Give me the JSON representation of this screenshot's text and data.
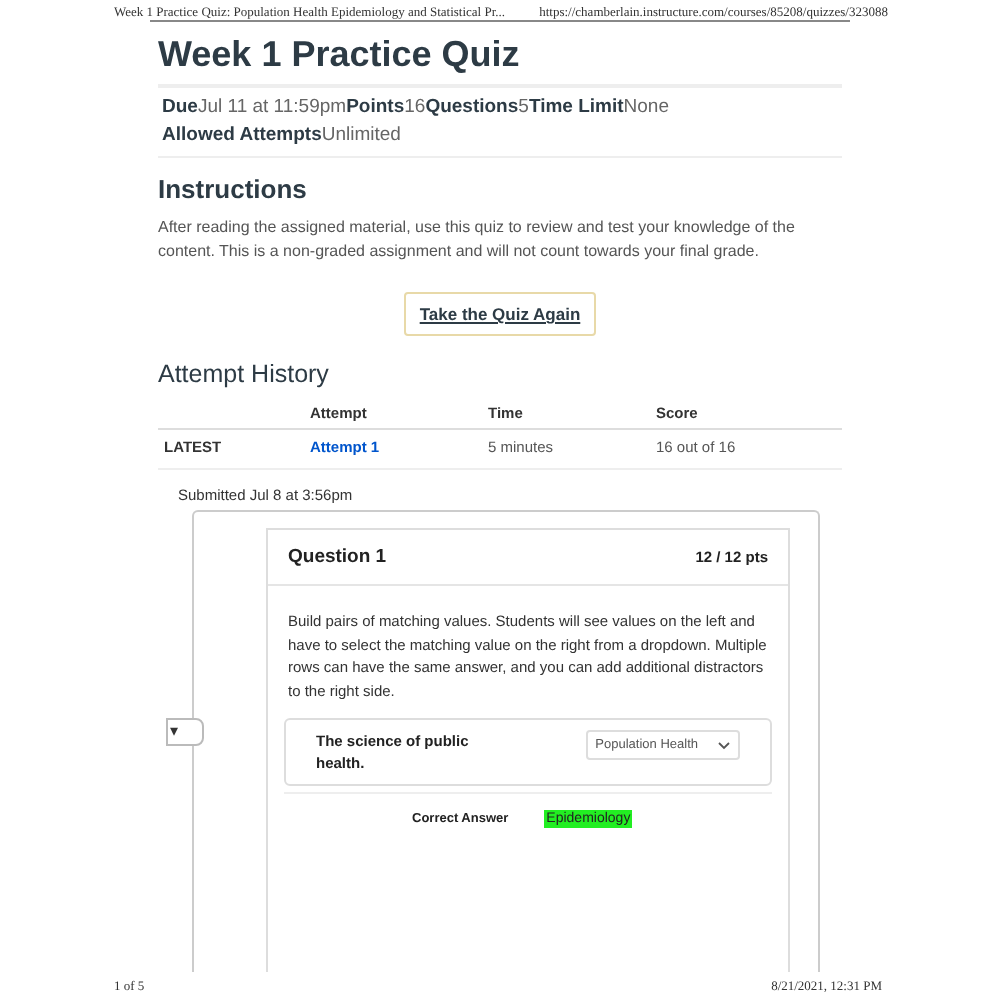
{
  "print_header": {
    "page_title": "Week 1 Practice Quiz: Population Health Epidemiology and Statistical Pr...",
    "url": "https://chamberlain.instructure.com/courses/85208/quizzes/323088"
  },
  "quiz": {
    "title": "Week 1 Practice Quiz",
    "details": [
      {
        "label": "Due",
        "value": "Jul 11 at 11:59pm"
      },
      {
        "label": "Points",
        "value": "16"
      },
      {
        "label": "Questions",
        "value": "5"
      },
      {
        "label": "Time Limit",
        "value": "None"
      }
    ],
    "allowed_attempts": {
      "label": "Allowed Attempts",
      "value": "Unlimited"
    }
  },
  "instructions": {
    "heading": "Instructions",
    "text": "After reading the assigned material, use this quiz to review and test your knowledge of the content. This is a non-graded assignment and will not count towards your final grade."
  },
  "retake_button": "Take the Quiz Again",
  "attempt_history": {
    "heading": "Attempt History",
    "columns": [
      "Attempt",
      "Time",
      "Score"
    ],
    "rows": [
      {
        "label": "LATEST",
        "attempt": "Attempt 1",
        "time": "5 minutes",
        "score": "16 out of 16"
      }
    ]
  },
  "submission": {
    "submitted": "Submitted Jul 8 at 3:56pm",
    "collapse_tab": "▾",
    "question": {
      "title": "Question 1",
      "points": "12 / 12 pts",
      "text": "Build pairs of matching values. Students will see values on the left and have to select the matching value on the right from a dropdown. Multiple rows can have the same answer, and you can add additional distractors to the right side.",
      "match": {
        "prompt": "The science of public health.",
        "selected_value": "Population Health"
      },
      "correct_label": "Correct Answer",
      "correct_value": "Epidemiology"
    }
  },
  "print_footer": {
    "page": "1 of 5",
    "timestamp": "8/21/2021, 12:31 PM"
  }
}
